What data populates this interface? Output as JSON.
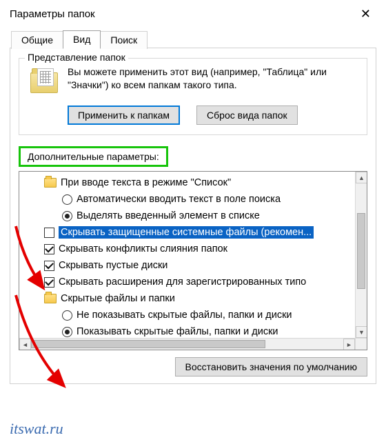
{
  "window": {
    "title": "Параметры папок"
  },
  "tabs": {
    "general": "Общие",
    "view": "Вид",
    "search": "Поиск"
  },
  "folder_view": {
    "legend": "Представление папок",
    "desc": "Вы можете применить этот вид (например, \"Таблица\" или \"Значки\") ко всем папкам такого типа.",
    "apply_btn": "Применить к папкам",
    "reset_btn": "Сброс вида папок"
  },
  "advanced_label": "Дополнительные параметры:",
  "tree": {
    "items": [
      {
        "kind": "folder",
        "indent": 1,
        "label": "При вводе текста в режиме \"Список\""
      },
      {
        "kind": "radio",
        "indent": 2,
        "selected": false,
        "label": "Автоматически вводить текст в поле поиска"
      },
      {
        "kind": "radio",
        "indent": 2,
        "selected": true,
        "label": "Выделять введенный элемент в списке"
      },
      {
        "kind": "check",
        "indent": 1,
        "selected": false,
        "highlight": true,
        "label": "Скрывать защищенные системные файлы (рекомен..."
      },
      {
        "kind": "check",
        "indent": 1,
        "selected": true,
        "label": "Скрывать конфликты слияния папок"
      },
      {
        "kind": "check",
        "indent": 1,
        "selected": true,
        "label": "Скрывать пустые диски"
      },
      {
        "kind": "check",
        "indent": 1,
        "selected": true,
        "label": "Скрывать расширения для зарегистрированных типо"
      },
      {
        "kind": "folder",
        "indent": 1,
        "label": "Скрытые файлы и папки"
      },
      {
        "kind": "radio",
        "indent": 2,
        "selected": false,
        "label": "Не показывать скрытые файлы, папки и диски"
      },
      {
        "kind": "radio",
        "indent": 2,
        "selected": true,
        "label": "Показывать скрытые файлы, папки и диски"
      }
    ]
  },
  "restore_defaults": "Восстановить значения по умолчанию",
  "watermark": "itswat.ru"
}
